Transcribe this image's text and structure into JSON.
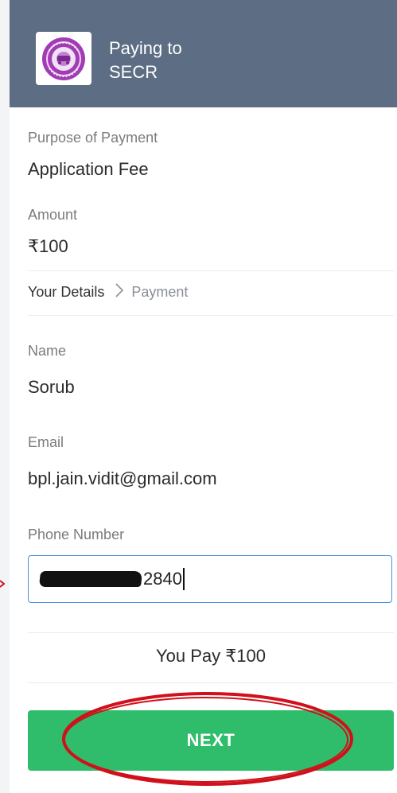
{
  "header": {
    "paying_to_label": "Paying to",
    "merchant_name": "SECR",
    "logo_icon": "indian-railways-emblem-icon",
    "background_color": "#5d6d84"
  },
  "purpose": {
    "label": "Purpose of Payment",
    "value": "Application Fee"
  },
  "amount": {
    "label": "Amount",
    "value": "₹100"
  },
  "steps": {
    "current": "Your Details",
    "next": "Payment"
  },
  "form": {
    "name": {
      "label": "Name",
      "value": "Sorub"
    },
    "email": {
      "label": "Email",
      "value": "bpl.jain.vidit@gmail.com"
    },
    "phone": {
      "label": "Phone Number",
      "visible_suffix": "2840"
    }
  },
  "summary": {
    "you_pay": "You Pay ₹100"
  },
  "next_button": {
    "label": "NEXT",
    "color": "#2fbd6b"
  },
  "annotation": {
    "color": "#d0101a"
  }
}
